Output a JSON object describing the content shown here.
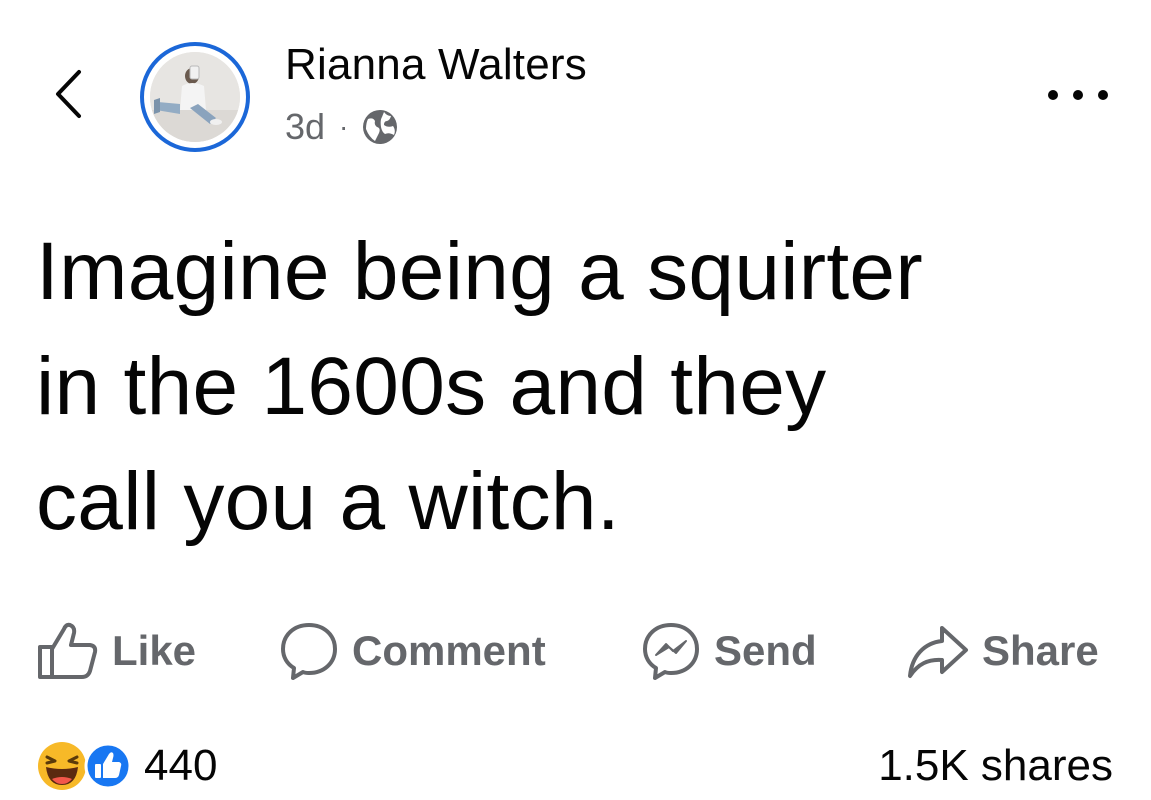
{
  "header": {
    "author_name": "Rianna Walters",
    "timestamp": "3d",
    "separator": "·",
    "audience_icon": "globe-icon",
    "back_icon": "chevron-left-icon",
    "more_icon": "more-dots-icon"
  },
  "post": {
    "text": "Imagine being a squirter\nin the 1600s and they\ncall you a witch."
  },
  "actions": {
    "like_label": "Like",
    "comment_label": "Comment",
    "send_label": "Send",
    "share_label": "Share"
  },
  "stats": {
    "reaction_icons": [
      "haha-reaction-icon",
      "like-reaction-icon"
    ],
    "reaction_count": "440",
    "shares": "1.5K shares"
  },
  "colors": {
    "accent_blue": "#1b67d8",
    "secondary_text": "#65676b",
    "primary_text": "#050505"
  }
}
